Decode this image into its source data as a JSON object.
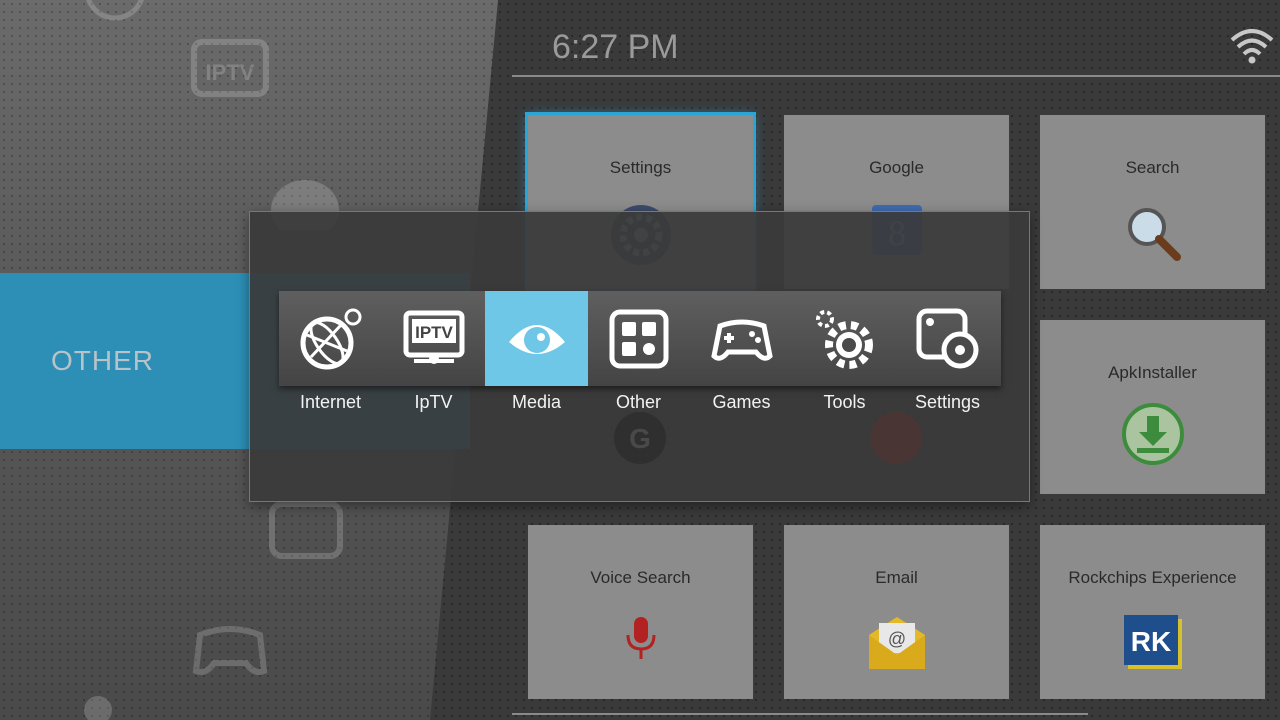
{
  "clock": "6:27 PM",
  "category": "OTHER",
  "tiles": [
    {
      "label": "Settings",
      "icon": "settings-icon"
    },
    {
      "label": "Google",
      "icon": "google-icon"
    },
    {
      "label": "Search",
      "icon": "search-icon"
    },
    {
      "label": "ApkInstaller",
      "icon": "apk-installer-icon"
    },
    {
      "label": "Voice Search",
      "icon": "microphone-icon"
    },
    {
      "label": "Email",
      "icon": "email-icon"
    },
    {
      "label": "Rockchips Experience",
      "icon": "rk-icon",
      "icon_text": "RK"
    }
  ],
  "menu": [
    {
      "label": "Internet",
      "icon": "globe-icon"
    },
    {
      "label": "IpTV",
      "icon": "iptv-icon",
      "icon_text": "IPTV"
    },
    {
      "label": "Media",
      "icon": "eye-icon"
    },
    {
      "label": "Other",
      "icon": "grid-icon"
    },
    {
      "label": "Games",
      "icon": "gamepad-icon"
    },
    {
      "label": "Tools",
      "icon": "gear-icon"
    },
    {
      "label": "Settings",
      "icon": "settings-cog-icon"
    }
  ],
  "active_menu": "Media",
  "colors": {
    "accent": "#2d8fb6",
    "active_menu": "#6ec7e6"
  }
}
